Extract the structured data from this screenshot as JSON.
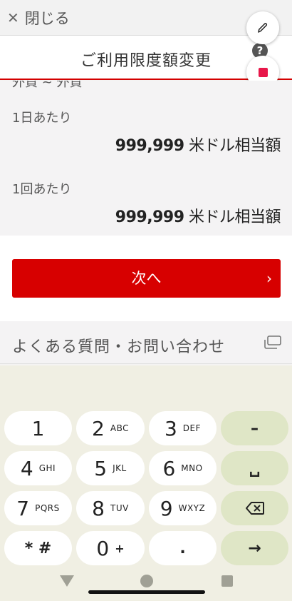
{
  "header": {
    "close_icon": "close-icon",
    "close_label": "閉じる"
  },
  "title": "ご利用限度額変更",
  "help_glyph": "?",
  "cut_off_text": "外貨 ~ 外貨",
  "limits": {
    "daily_label": "1日あたり",
    "daily_value": "999,999",
    "daily_unit": " 米ドル相当額",
    "per_tx_label": "1回あたり",
    "per_tx_value": "999,999",
    "per_tx_unit": " 米ドル相当額"
  },
  "next_button": {
    "label": "次へ",
    "chevron": "›"
  },
  "faq_label": "よくある質問・お問い合わせ",
  "keyboard": {
    "k1": "1",
    "k2": "2",
    "k2l": "ABC",
    "k3": "3",
    "k3l": "DEF",
    "minus": "–",
    "k4": "4",
    "k4l": "GHI",
    "k5": "5",
    "k5l": "JKL",
    "k6": "6",
    "k6l": "MNO",
    "space": "␣",
    "k7": "7",
    "k7l": "PQRS",
    "k8": "8",
    "k8l": "TUV",
    "k9": "9",
    "k9l": "WXYZ",
    "star": "* #",
    "k0": "0",
    "plus": "+",
    "dot": ".",
    "enter": "→"
  },
  "colors": {
    "accent": "#d70000",
    "stop": "#e8174a",
    "keyboard_bg": "#f0efe3",
    "action_key": "#dfe6c6"
  }
}
